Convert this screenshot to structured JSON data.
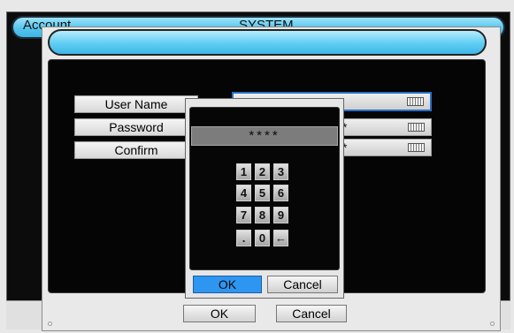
{
  "background_window": {
    "tab_label": "Account",
    "title": "SYSTEM"
  },
  "dialog": {
    "title": "",
    "rows": [
      {
        "label": "User Name",
        "value": "",
        "active": true
      },
      {
        "label": "Password",
        "value": "*",
        "active": false
      },
      {
        "label": "Confirm",
        "value": "*",
        "active": false
      }
    ],
    "ok_label": "OK",
    "cancel_label": "Cancel"
  },
  "keypad": {
    "display": "****",
    "keys": [
      "1",
      "2",
      "3",
      "4",
      "5",
      "6",
      "7",
      "8",
      "9",
      ".",
      "0",
      "←"
    ],
    "ok_label": "OK",
    "cancel_label": "Cancel"
  },
  "colors": {
    "title_bar": "#55c5ee",
    "ok_active": "#2e96f0",
    "active_field_border": "#2a6fc9"
  }
}
